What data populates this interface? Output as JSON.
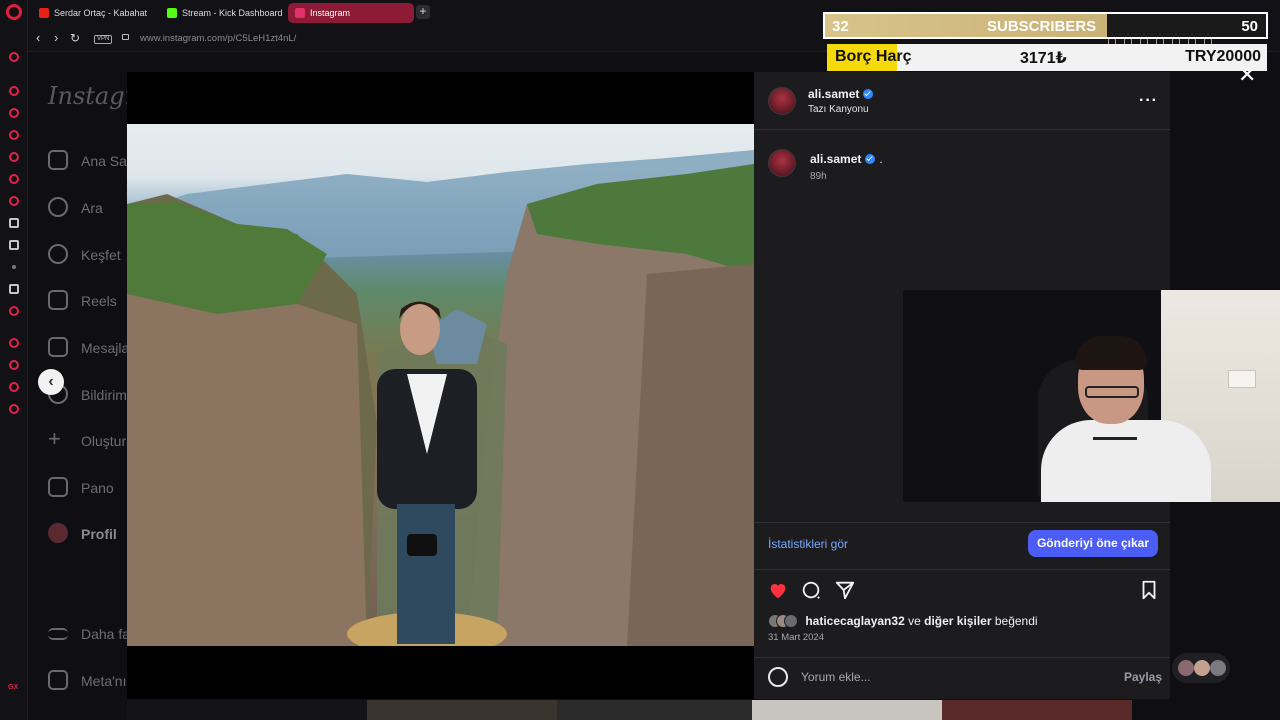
{
  "browser": {
    "tabs": [
      {
        "label": "Serdar Ortaç - Kabahat",
        "favicon": "youtube-icon",
        "color": "#e62117"
      },
      {
        "label": "Stream - Kick Dashboard",
        "favicon": "kick-icon",
        "color": "#53fc18"
      },
      {
        "label": "Instagram",
        "favicon": "instagram-icon",
        "color": "#e1306c"
      }
    ],
    "vpn_label": "VPN",
    "url": "www.instagram.com/p/C5LeH1zt4nL/"
  },
  "instagram": {
    "logo": "Instagram",
    "nav": [
      {
        "label": "Ana Sayfa",
        "icon": "home-icon"
      },
      {
        "label": "Ara",
        "icon": "search-icon"
      },
      {
        "label": "Keşfet",
        "icon": "compass-icon"
      },
      {
        "label": "Reels",
        "icon": "reels-icon"
      },
      {
        "label": "Mesajlar",
        "icon": "messages-icon"
      },
      {
        "label": "Bildirimler",
        "icon": "heart-icon"
      },
      {
        "label": "Oluştur",
        "icon": "plus-icon"
      },
      {
        "label": "Pano",
        "icon": "chart-icon"
      },
      {
        "label": "Profil",
        "icon": "avatar-icon"
      },
      {
        "label": "Daha fazla",
        "icon": "menu-icon"
      },
      {
        "label": "Meta'nın",
        "icon": "meta-icon"
      }
    ]
  },
  "post": {
    "username": "ali.samet",
    "location": "Tazı Kanyonu",
    "caption_user": "ali.samet",
    "caption_text": ".",
    "age": "89h",
    "stats_link": "İstatistikleri gör",
    "boost_button": "Gönderiyi öne çıkar",
    "liked_by_user": "haticecaglayan32",
    "liked_by_connector": "ve",
    "liked_by_others": "diğer kişiler",
    "liked_by_suffix": "beğendi",
    "date": "31 Mart 2024",
    "comment_placeholder": "Yorum ekle...",
    "share_label": "Paylaş",
    "liked": true,
    "like_color": "#ff3040"
  },
  "stream_overlay": {
    "subscribers": {
      "current": "32",
      "label": "SUBSCRIBERS",
      "goal": "50",
      "progress": 0.64
    },
    "debt": {
      "label": "Borç Harç",
      "value": "3171₺",
      "goal": "TRY20000",
      "progress": 0.16
    }
  },
  "colors": {
    "accent_blue": "#4b5df5",
    "link_blue": "#7aa9ff",
    "opera_red": "#e01f3d"
  }
}
